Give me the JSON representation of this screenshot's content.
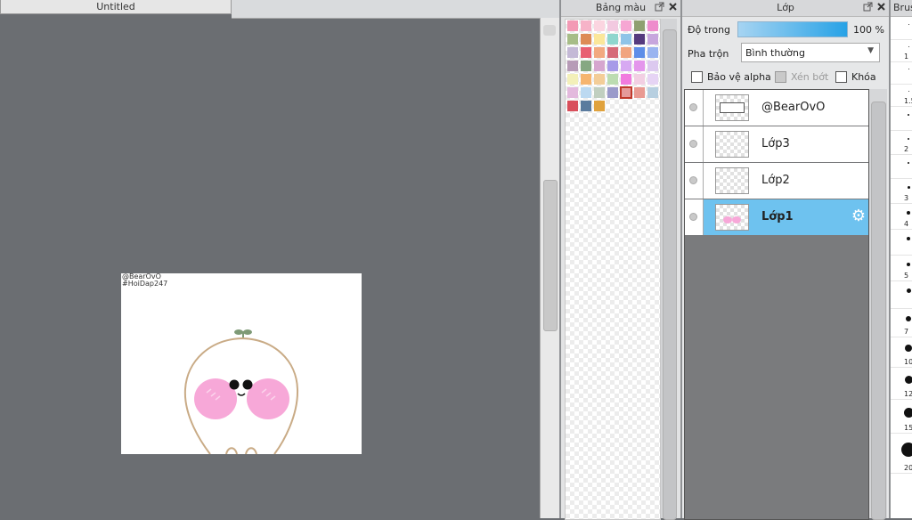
{
  "document": {
    "tab_title": "Untitled"
  },
  "canvas": {
    "watermark_line1": "@BearOvO",
    "watermark_line2": "#HoiDap247"
  },
  "palette_panel": {
    "title": "Bảng màu",
    "selected_index": 39,
    "swatches": [
      "#f39ab5",
      "#f6b3c8",
      "#fbd5e0",
      "#f2c9e0",
      "#f6a6d3",
      "#8fa071",
      "#ee8ccc",
      "#a7bd87",
      "#dd8b55",
      "#fbe79a",
      "#8fd6ce",
      "#8fc4e8",
      "#553a7e",
      "#c7a6dd",
      "#c4b9d6",
      "#e85f72",
      "#f2a97f",
      "#d66a78",
      "#f1a57f",
      "#5e8ee8",
      "#9ab4f0",
      "#b79bb7",
      "#86a882",
      "#d6a6cf",
      "#a79be8",
      "#d7a9f2",
      "#e496ec",
      "#dcc9ef",
      "#f3f0b9",
      "#f6b56f",
      "#f3cd98",
      "#bcdcb1",
      "#f17bde",
      "#f2cfe3",
      "#e6d4f4",
      "#e3b9dd",
      "#bcd9f1",
      "#c1cfc0",
      "#9a9aca",
      "#e59a9a",
      "#e99a92",
      "#b7cfe0",
      "#d94f5b",
      "#5a7b9e",
      "#e0a23d"
    ]
  },
  "layer_panel": {
    "title": "Lớp",
    "opacity_label": "Độ trong",
    "opacity_value": "100 %",
    "opacity_fraction": 1.0,
    "blend_label": "Pha trộn",
    "blend_value": "Bình thường",
    "protect_alpha": "Bảo vệ alpha",
    "clipping": "Xén bớt",
    "lock": "Khóa",
    "layers": [
      {
        "name": "@BearOvO",
        "selected": false
      },
      {
        "name": "Lớp3",
        "selected": false
      },
      {
        "name": "Lớp2",
        "selected": false
      },
      {
        "name": "Lớp1",
        "selected": true
      }
    ]
  },
  "brush_panel": {
    "title": "Brush",
    "sizes": [
      "",
      "1",
      "",
      "1.5",
      "",
      "2",
      "",
      "3",
      "4",
      "",
      "5",
      "",
      "7",
      "10",
      "12",
      "15",
      "20"
    ]
  },
  "colors": {
    "canvas_bg": "#6b6e72",
    "selection": "#6ec2ef",
    "opacity_bar_start": "#a6d4f2",
    "opacity_bar_end": "#27a2e6",
    "blush": "#f7a8d8",
    "character_outline": "#c9ab86",
    "sprout": "#7e9a76"
  },
  "icons": {
    "float_button": "external-window-icon",
    "close_button": "close-x-icon",
    "layer_settings": "gear-icon",
    "visibility": "eye-dot-icon"
  }
}
